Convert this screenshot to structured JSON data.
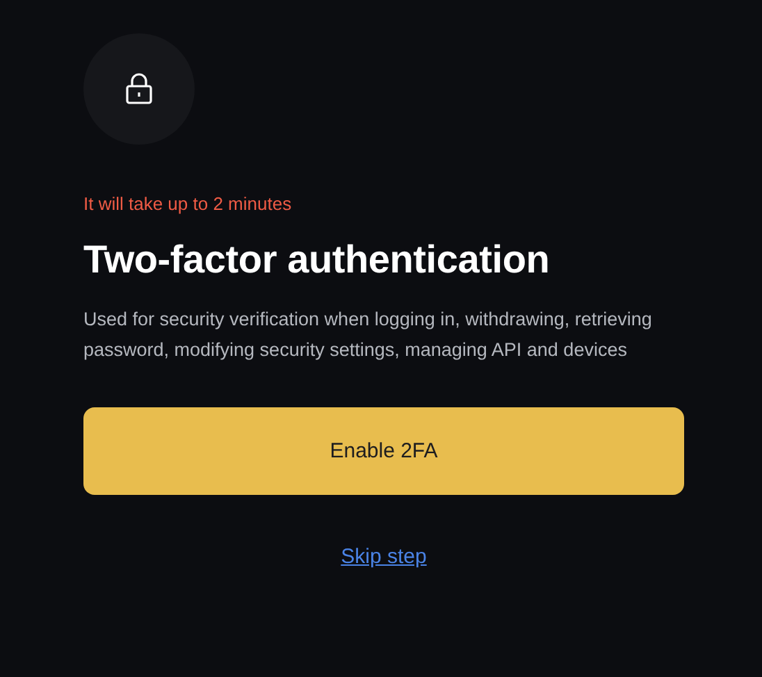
{
  "note": "It will take up to 2 minutes",
  "title": "Two-factor authentication",
  "description": "Used for security verification when logging in, withdrawing, retrieving password, modifying security settings, managing API and devices",
  "primary_button": "Enable 2FA",
  "skip_link": "Skip step"
}
